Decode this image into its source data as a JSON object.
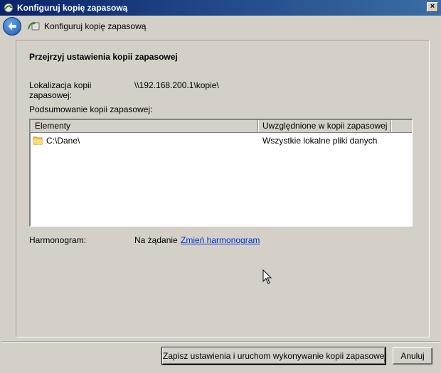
{
  "window": {
    "title": "Konfiguruj kopię zapasową",
    "close_label": "×"
  },
  "navbar": {
    "title": "Konfiguruj kopię zapasową"
  },
  "panel": {
    "heading": "Przejrzyj ustawienia kopii zapasowej",
    "location_label": "Lokalizacja kopii zapasowej:",
    "location_value": "\\\\192.168.200.1\\kopie\\",
    "summary_label": "Podsumowanie kopii zapasowej:",
    "table": {
      "columns": [
        "Elementy",
        "Uwzględnione w kopii zapasowej"
      ],
      "rows": [
        {
          "element": "C:\\Dane\\",
          "included": "Wszystkie lokalne pliki danych"
        }
      ]
    },
    "schedule_label": "Harmonogram:",
    "schedule_value": "Na żądanie",
    "schedule_link": "Zmień harmonogram"
  },
  "buttons": {
    "save_label": "Zapisz ustawienia i uruchom wykonywanie kopii zapasowej",
    "cancel_label": "Anuluj"
  },
  "icons": {
    "app": "backup-app-icon",
    "back": "back-arrow-icon",
    "nav": "backup-icon",
    "folder": "folder-icon",
    "cursor": "mouse-pointer-icon"
  }
}
